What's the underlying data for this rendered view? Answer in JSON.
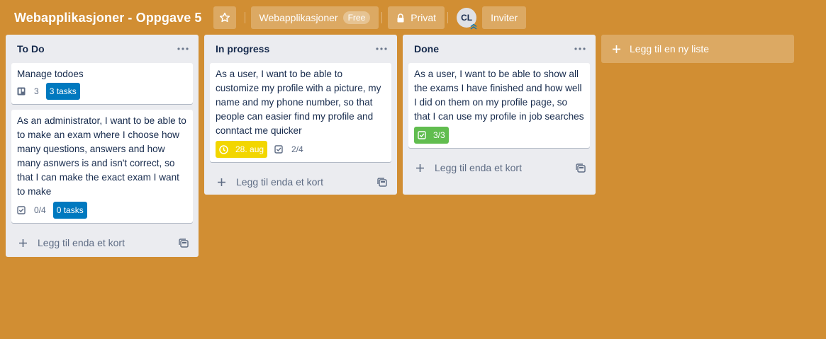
{
  "board": {
    "title": "Webapplikasjoner - Oppgave 5",
    "workspace": "Webapplikasjoner",
    "plan_badge": "Free",
    "visibility": "Privat",
    "avatar_initials": "CL",
    "invite_label": "Inviter",
    "background_color": "#d18e33"
  },
  "lists": [
    {
      "title": "To Do",
      "cards": [
        {
          "text": "Manage todoes",
          "attachments": "3",
          "tasks_label": "3 tasks"
        },
        {
          "text": "As an administrator, I want to be able to to make an exam where I choose how many questions, answers and how many asnwers is and isn't correct, so that I can make the exact exam I want to make",
          "checklist": "0/4",
          "tasks_label": "0 tasks"
        }
      ],
      "add_card_label": "Legg til enda et kort"
    },
    {
      "title": "In progress",
      "cards": [
        {
          "text": "As a user, I want to be able to customize my profile with a picture, my name and my phone number, so that people can easier find my profile and conntact me quicker",
          "due": "28. aug",
          "checklist": "2/4"
        }
      ],
      "add_card_label": "Legg til enda et kort"
    },
    {
      "title": "Done",
      "cards": [
        {
          "text": "As a user, I want to be able to show all the exams I have finished and how well I did on them on my profile page, so that I can use my profile in job searches",
          "checklist_complete": "3/3"
        }
      ],
      "add_card_label": "Legg til enda et kort"
    }
  ],
  "add_list_label": "Legg til en ny liste",
  "colors": {
    "task_label": "#0079bf",
    "due_badge": "#f2d600",
    "complete_badge": "#61bd4f"
  },
  "icons": [
    "star-icon",
    "lock-icon",
    "ellipsis-icon",
    "attachment-icon",
    "checklist-icon",
    "clock-icon",
    "plus-icon",
    "template-icon"
  ]
}
